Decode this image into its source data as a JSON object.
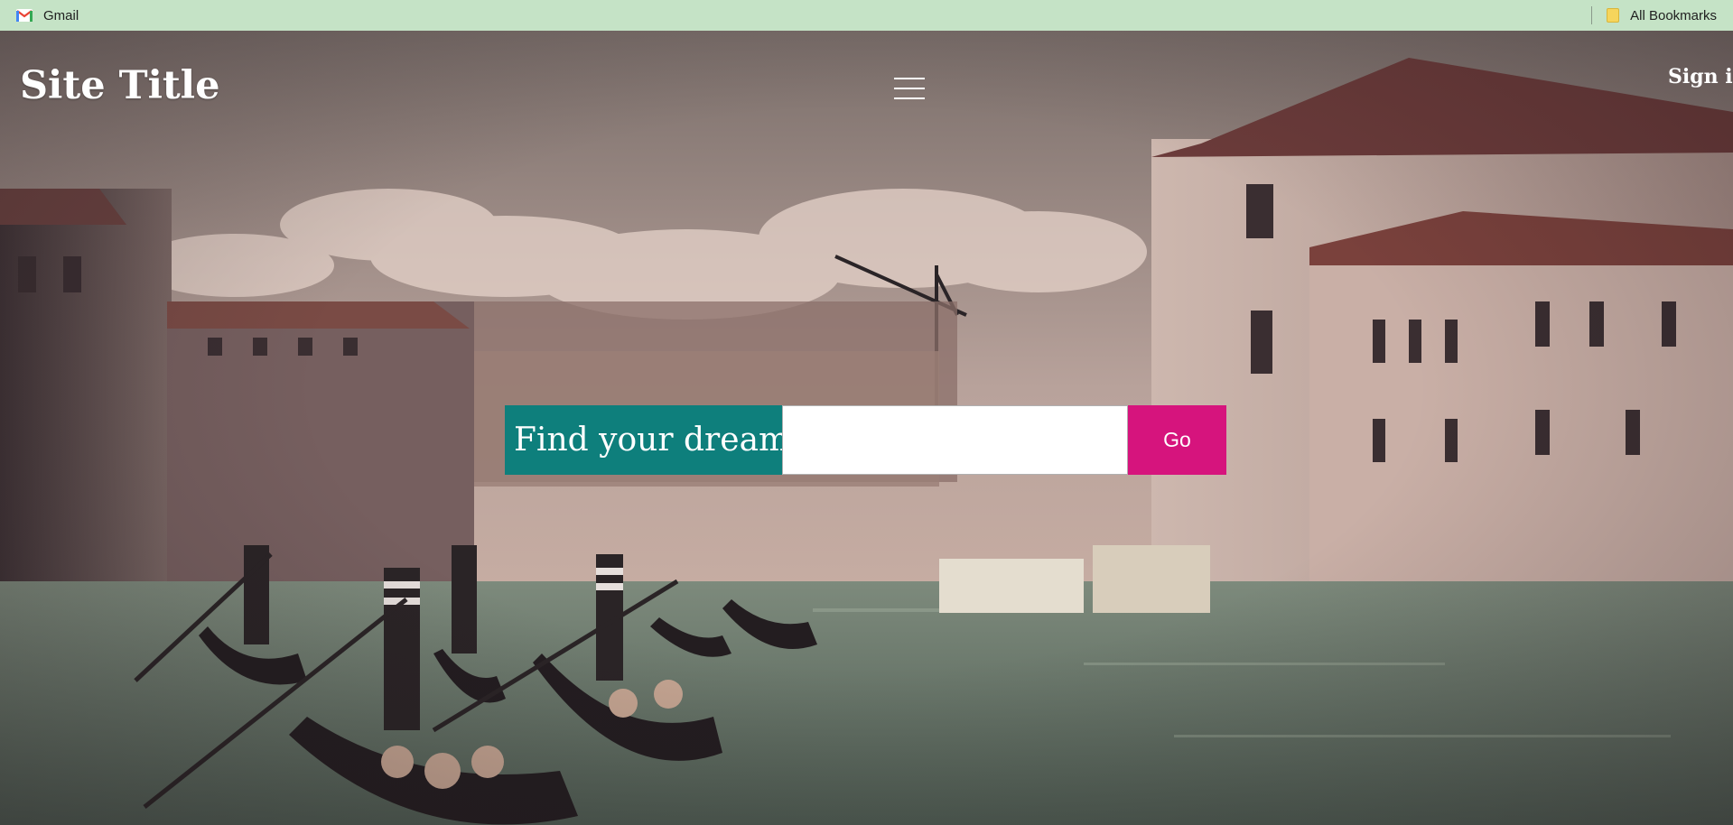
{
  "bookmarks": {
    "gmail_label": "Gmail",
    "all_bookmarks_label": "All Bookmarks"
  },
  "header": {
    "site_title": "Site Title",
    "sign_in_label": "Sign in"
  },
  "search": {
    "label": "Find your dream",
    "input_value": "",
    "button_label": "Go"
  },
  "colors": {
    "bookmarks_bar": "#c5e3c6",
    "search_label_bg": "#0e7f7c",
    "go_button_bg": "#d6147d"
  }
}
